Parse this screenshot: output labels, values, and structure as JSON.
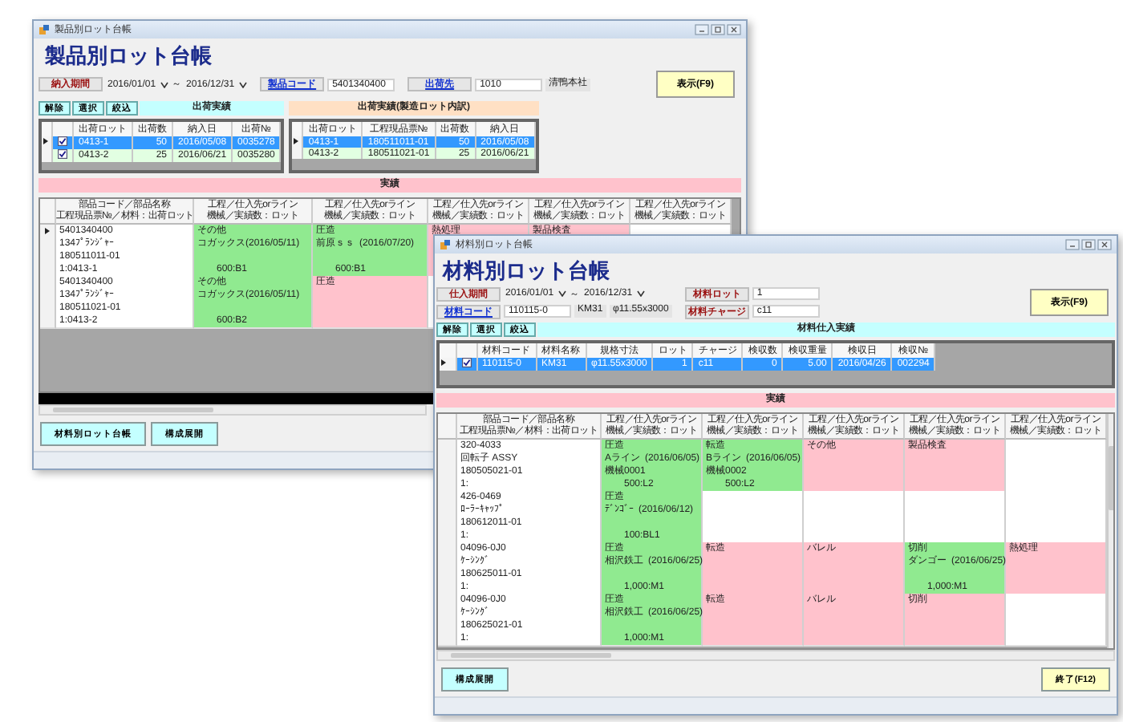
{
  "windows": [
    {
      "title": "製品別ロット台帳",
      "heading": "製品別ロット台帳",
      "filter_rows": [
        [
          {
            "kind": "date_range",
            "label": "納入期間",
            "link": false,
            "from": "2016/01/01",
            "separator": "～",
            "to": "2016/12/31"
          },
          {
            "kind": "text",
            "label": "製品コード",
            "link": true,
            "values": [
              "5401340400"
            ]
          },
          {
            "kind": "text",
            "label": "出荷先",
            "link": true,
            "values": [
              "1010",
              "清鴨本社"
            ]
          }
        ]
      ],
      "show_button": "表示(F9)",
      "panels": [
        {
          "title": "出荷実績",
          "color": "#c4ffff",
          "buttons": [
            "解除",
            "選択",
            "絞込"
          ],
          "grid": {
            "columns": [
              "出荷ロット",
              "出荷数",
              "納入日",
              "出荷№"
            ],
            "rows": [
              {
                "selected": true,
                "checked": true,
                "cells": [
                  "0413-1",
                  "50",
                  "2016/05/08",
                  "0035278"
                ]
              },
              {
                "selected": false,
                "checked": true,
                "cells": [
                  "0413-2",
                  "25",
                  "2016/06/21",
                  "0035280"
                ]
              }
            ]
          }
        },
        {
          "title": "出荷実績(製造ロット内訳)",
          "color": "#ffe0c4",
          "grid": {
            "columns": [
              "出荷ロット",
              "工程現品票№",
              "出荷数",
              "納入日"
            ],
            "rows": [
              {
                "selected": true,
                "cells": [
                  "0413-1",
                  "180511011-01",
                  "50",
                  "2016/05/08"
                ]
              },
              {
                "selected": false,
                "cells": [
                  "0413-2",
                  "180511021-01",
                  "25",
                  "2016/06/21"
                ]
              }
            ]
          }
        }
      ],
      "banner": "実績",
      "table": {
        "key_header": [
          "部品コード／部品名称",
          "工程現品票№／材料：出荷ロット"
        ],
        "columns": [
          {
            "line_1": "工程／仕入先orライン",
            "line_2": "機械／実績数：ロット"
          },
          {
            "line_1": "工程／仕入先orライン",
            "line_2": "機械／実績数：ロット"
          },
          {
            "line_1": "工程／仕入先orライン",
            "line_2": "機械／実績数：ロット"
          },
          {
            "line_1": "工程／仕入先orライン",
            "line_2": "機械／実績数：ロット"
          },
          {
            "line_1": "工程／仕入先orライン",
            "line_2": "機械／実績数：ロット"
          }
        ],
        "groups": [
          {
            "selected": true,
            "lines": [
              "5401340400",
              "134ﾌﾟﾗﾝｼﾞｬｰ",
              "180511011-01",
              "1:0413-1"
            ],
            "processes": [
              {
                "color": "#90ea90",
                "process": "その他",
                "supplier": "コガックス(2016/05/11)",
                "qty": "600:B1"
              },
              {
                "color": "#90ea90",
                "process": "圧造",
                "supplier": "前原ｓｓ",
                "date": "(2016/07/20)",
                "qty": "600:B1"
              },
              {
                "color": "#ffc2cc",
                "process": "熱処理"
              },
              {
                "color": "#ffc2cc",
                "process": "製品検査"
              },
              {
                "color": "#ffffff"
              }
            ]
          },
          {
            "selected": false,
            "lines": [
              "5401340400",
              "134ﾌﾟﾗﾝｼﾞｬｰ",
              "180511021-01",
              "1:0413-2"
            ],
            "processes": [
              {
                "color": "#90ea90",
                "process": "その他",
                "supplier": "コガックス(2016/05/11)",
                "qty": "600:B2"
              },
              {
                "color": "#ffc2cc",
                "process": "圧造"
              }
            ]
          }
        ]
      },
      "dark_band": true,
      "footer_buttons": [
        {
          "label": "材料別ロット台帳",
          "color": "#c4ffff"
        },
        {
          "label": "構成展開",
          "color": "#c4ffff"
        }
      ]
    },
    {
      "title": "材料別ロット台帳",
      "heading": "材料別ロット台帳",
      "filter_rows": [
        [
          {
            "kind": "date_range",
            "label": "仕入期間",
            "link": false,
            "from": "2016/01/01",
            "separator": "～",
            "to": "2016/12/31"
          },
          {
            "kind": "text",
            "label": "材料ロット",
            "link": false,
            "values": [
              "1"
            ]
          }
        ],
        [
          {
            "kind": "text",
            "label": "材料コード",
            "link": true,
            "values": [
              "110115-0",
              "KM31",
              "φ11.55x3000"
            ]
          },
          {
            "kind": "text",
            "label": "材料チャージ",
            "link": false,
            "values": [
              "c11"
            ]
          }
        ]
      ],
      "show_button": "表示(F9)",
      "panels": [
        {
          "title": "材料仕入実績",
          "color": "#c4ffff",
          "buttons": [
            "解除",
            "選択",
            "絞込"
          ],
          "grid": {
            "columns": [
              "材料コード",
              "材料名称",
              "規格寸法",
              "ロット",
              "チャージ",
              "検収数",
              "検収重量",
              "検収日",
              "検収№"
            ],
            "rows": [
              {
                "selected": true,
                "checked": true,
                "cells": [
                  "110115-0",
                  "KM31",
                  "φ11.55x3000",
                  "1",
                  "c11",
                  "0",
                  "5.00",
                  "2016/04/26",
                  "002294"
                ]
              }
            ]
          }
        }
      ],
      "banner": "実績",
      "table": {
        "key_header": [
          "部品コード／部品名称",
          "工程現品票№／材料：出荷ロット"
        ],
        "columns": [
          {
            "line_1": "工程／仕入先orライン",
            "line_2": "機械／実績数：ロット"
          },
          {
            "line_1": "工程／仕入先orライン",
            "line_2": "機械／実績数：ロット"
          },
          {
            "line_1": "工程／仕入先orライン",
            "line_2": "機械／実績数：ロット"
          },
          {
            "line_1": "工程／仕入先orライン",
            "line_2": "機械／実績数：ロット"
          },
          {
            "line_1": "工程／仕入先orライン",
            "line_2": "機械／実績数：ロット"
          }
        ],
        "vertical_scrollbar": true,
        "groups": [
          {
            "selected": false,
            "lines": [
              "320-4033",
              "回転子 ASSY",
              "180505021-01",
              "1:"
            ],
            "processes": [
              {
                "color": "#90ea90",
                "process": "圧造",
                "supplier": "Aライン",
                "date": "(2016/06/05)",
                "machine": "機械0001",
                "qty": "500:L2"
              },
              {
                "color": "#90ea90",
                "process": "転造",
                "supplier": "Bライン",
                "date": "(2016/06/05)",
                "machine": "機械0002",
                "qty": "500:L2"
              },
              {
                "color": "#ffc2cc",
                "process": "その他"
              },
              {
                "color": "#ffc2cc",
                "process": "製品検査"
              },
              {
                "color": "#ffffff"
              }
            ]
          },
          {
            "selected": false,
            "lines": [
              "426-0469",
              "ﾛｰﾗｰｷｬｯﾌﾟ",
              "180612011-01",
              "1:"
            ],
            "processes": [
              {
                "color": "#90ea90",
                "process": "圧造",
                "supplier": "ﾃﾞﾝｺﾞｰ",
                "date": "(2016/06/12)",
                "qty": "100:BL1"
              },
              {
                "color": "#ffffff"
              },
              {
                "color": "#ffffff"
              },
              {
                "color": "#ffffff"
              },
              {
                "color": "#ffffff"
              }
            ]
          },
          {
            "selected": false,
            "lines": [
              "04096-0J0",
              "ｹｰｼﾝｸﾞ",
              "180625011-01",
              "1:"
            ],
            "processes": [
              {
                "color": "#90ea90",
                "process": "圧造",
                "supplier": "相沢鉄工",
                "date": "(2016/06/25)",
                "qty": "1,000:M1"
              },
              {
                "color": "#ffc2cc",
                "process": "転造"
              },
              {
                "color": "#ffc2cc",
                "process": "バレル"
              },
              {
                "color": "#90ea90",
                "process": "切削",
                "supplier": "ダンゴー",
                "date": "(2016/06/25)",
                "qty": "1,000:M1"
              },
              {
                "color": "#ffc2cc",
                "process": "熱処理"
              }
            ]
          },
          {
            "selected": false,
            "lines": [
              "04096-0J0",
              "ｹｰｼﾝｸﾞ",
              "180625021-01",
              "1:"
            ],
            "processes": [
              {
                "color": "#90ea90",
                "process": "圧造",
                "supplier": "相沢鉄工",
                "date": "(2016/06/25)",
                "qty": "1,000:M1"
              },
              {
                "color": "#ffc2cc",
                "process": "転造"
              },
              {
                "color": "#ffc2cc",
                "process": "バレル"
              },
              {
                "color": "#ffc2cc",
                "process": "切削"
              },
              {
                "color": "#ffffff"
              }
            ]
          }
        ]
      },
      "footer_buttons": [
        {
          "label": "構成展開",
          "color": "#c4ffff"
        }
      ],
      "exit_button": {
        "label": "終了(F12)",
        "color": "#ffffc4"
      }
    }
  ]
}
